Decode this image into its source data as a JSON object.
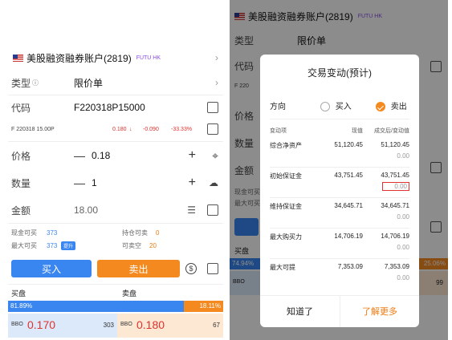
{
  "account": {
    "name": "美股融资融券账户(2819)",
    "tag": "FUTU HK"
  },
  "order_type": {
    "label": "类型",
    "value": "限价单"
  },
  "code": {
    "label": "代码",
    "value": "F220318P15000"
  },
  "quote": {
    "ticker": "F 220318 15.00P",
    "price": "0.180",
    "arrow": "↓",
    "change": "-0.090",
    "pct": "-33.33%"
  },
  "price": {
    "label": "价格",
    "value": "0.18"
  },
  "qty": {
    "label": "数量",
    "value": "1"
  },
  "amount": {
    "label": "金额",
    "value": "18.00"
  },
  "funds": {
    "cash_buy_label": "现金可买",
    "cash_buy": "373",
    "hold_sell_label": "持仓可卖",
    "hold_sell": "0",
    "max_buy_label": "最大可买",
    "max_buy": "373",
    "raise": "提升",
    "short_label": "可卖空",
    "short": "20"
  },
  "actions": {
    "buy": "买入",
    "sell": "卖出"
  },
  "book": {
    "bid_label": "买盘",
    "ask_label": "卖盘",
    "bid_pct": "81.89%",
    "ask_pct": "18.11%",
    "bid_ratio": 0.8189,
    "bbo": "BBO",
    "bid_price": "0.170",
    "bid_size": "303",
    "ask_price": "0.180",
    "ask_size": "67"
  },
  "right_bg": {
    "account": "美股融资融券账户(2819)",
    "tag": "FUTU HK",
    "type_label": "类型",
    "type_value": "限价单",
    "code_label": "代码",
    "price_label": "价格",
    "qty_label": "数量",
    "amount_label": "金额",
    "f_label": "F 220",
    "cash_label": "现金可买",
    "max_label": "最大可买",
    "bid_label": "买盘",
    "bid_pct": "74.94%",
    "ask_pct": "25.06%",
    "bbo": "BBO",
    "ask_size": "99"
  },
  "modal": {
    "title": "交易变动(预计)",
    "direction_label": "方向",
    "buy": "买入",
    "sell": "卖出",
    "col_item": "变动项",
    "col_now": "现值",
    "col_after": "成交后/变动值",
    "rows": [
      {
        "item": "综合净资产",
        "now": "51,120.45",
        "after": "51,120.45",
        "delta": "0.00"
      },
      {
        "item": "初始保证金",
        "now": "43,751.45",
        "after": "43,751.45",
        "delta": "0.00"
      },
      {
        "item": "维持保证金",
        "now": "34,645.71",
        "after": "34,645.71",
        "delta": "0.00"
      },
      {
        "item": "最大购买力",
        "now": "14,706.19",
        "after": "14,706.19",
        "delta": "0.00"
      },
      {
        "item": "最大可提",
        "now": "7,353.09",
        "after": "7,353.09",
        "delta": "0.00"
      }
    ],
    "ok": "知道了",
    "more": "了解更多"
  }
}
